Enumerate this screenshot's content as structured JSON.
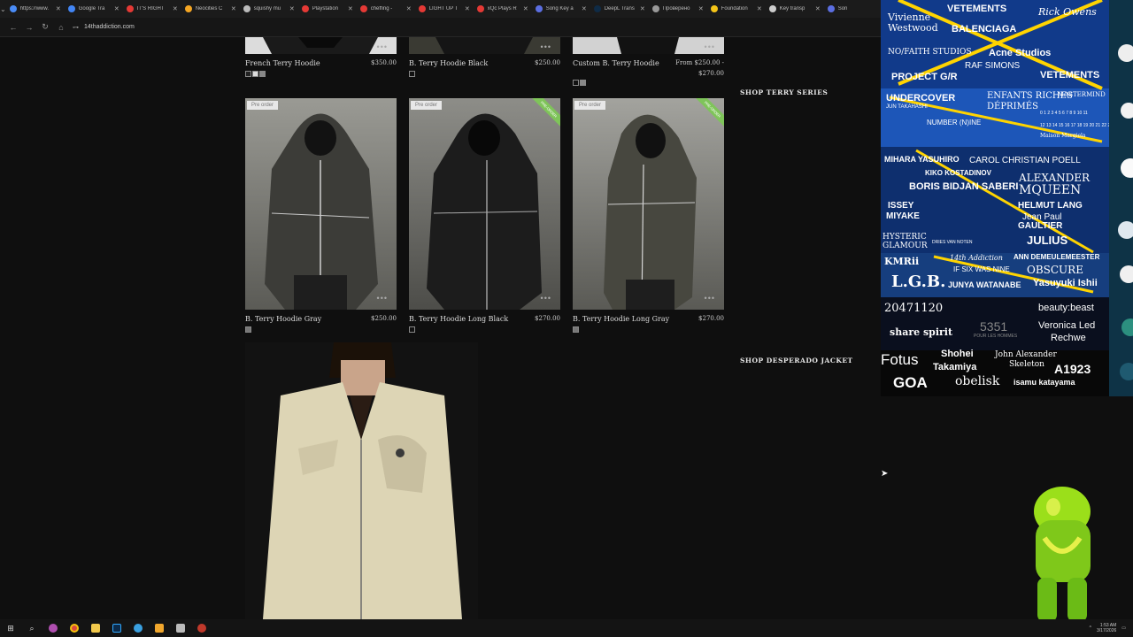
{
  "browser": {
    "tabs": [
      {
        "label": "https://www.",
        "color": "#4a8cf7"
      },
      {
        "label": "Google Tra",
        "color": "#4285f4"
      },
      {
        "label": "IT'S RIGHT",
        "color": "#e53935"
      },
      {
        "label": "Neocities C",
        "color": "#f5a623"
      },
      {
        "label": "squishy mu",
        "color": "#bbbbbb"
      },
      {
        "label": "Playstation",
        "color": "#e53935"
      },
      {
        "label": "cheffing -",
        "color": "#e53935"
      },
      {
        "label": "LIGHT UP T",
        "color": "#e53935"
      },
      {
        "label": "xQc Plays R",
        "color": "#e53935"
      },
      {
        "label": "Song Key a",
        "color": "#5b6ee1"
      },
      {
        "label": "DeepL Trans",
        "color": "#0f2b46"
      },
      {
        "label": "Проверено",
        "color": "#999999"
      },
      {
        "label": "Foundation",
        "color": "#f5c518"
      },
      {
        "label": "Key transp",
        "color": "#cccccc"
      },
      {
        "label": "Son",
        "color": "#5b6ee1"
      }
    ],
    "tab_close": "✕",
    "tab_list_icon": "⌄",
    "nav": {
      "back": "←",
      "forward": "→",
      "reload": "↻",
      "home": "⌂"
    },
    "url": "14thaddiction.com",
    "site_icon": "⊶"
  },
  "products": [
    {
      "name": "French Terry Hoodie",
      "price": "$350.00",
      "swatches": [
        "#222222",
        "#dddddd",
        "#888888"
      ]
    },
    {
      "name": "B. Terry Hoodie Black",
      "price": "$250.00",
      "swatches": [
        "#111111"
      ]
    },
    {
      "name": "Custom B. Terry Hoodie",
      "price": "From $250.00 -",
      "price2": "$270.00",
      "swatches": [
        "#111111",
        "#888888"
      ]
    },
    {
      "name": "B. Terry Hoodie Gray",
      "price": "$250.00",
      "badge": "Pre order",
      "swatches": [
        "#777777"
      ]
    },
    {
      "name": "B. Terry Hoodie Long Black",
      "price": "$270.00",
      "badge": "Pre order",
      "ribbon": "PRE-ORDER",
      "swatches": [
        "#111111"
      ]
    },
    {
      "name": "B. Terry Hoodie Long Gray",
      "price": "$270.00",
      "badge": "Pre order",
      "ribbon": "PRE-ORDER",
      "swatches": [
        "#777777"
      ]
    }
  ],
  "more_icon": "•••",
  "shop_links": {
    "terry": "SHOP TERRY SERIES",
    "desperado": "SHOP DESPERADO JACKET"
  },
  "collage": {
    "brands": [
      {
        "text": "Vivienne",
        "color": "#ffffff"
      },
      {
        "text": "Westwood",
        "color": "#ffffff"
      },
      {
        "text": "VETEMENTS",
        "color": "#ffffff"
      },
      {
        "text": "BALENCIAGA",
        "color": "#ffffff"
      },
      {
        "text": "Rick Owens",
        "color": "#ffffff"
      },
      {
        "text": "NO/FAITH STUDIOS",
        "color": "#ffffff"
      },
      {
        "text": "Acne Studios",
        "color": "#ffffff"
      },
      {
        "text": "RAF SIMONS",
        "color": "#ffffff"
      },
      {
        "text": "PROJECT G/R",
        "color": "#ffffff"
      },
      {
        "text": "VETEMENTS",
        "color": "#ffffff"
      },
      {
        "text": "UNDERCOVER",
        "color": "#ffffff"
      },
      {
        "text": "JUN TAKAHASHI",
        "color": "#ffffff"
      },
      {
        "text": "ENFANTS RICHES",
        "color": "#ffffff"
      },
      {
        "text": "DÉPRIMÉS",
        "color": "#ffffff"
      },
      {
        "text": "MASTERMIND",
        "color": "#ffffff"
      },
      {
        "text": "NUMBER (N)INE",
        "color": "#ffffff"
      },
      {
        "text": "0 1 2 3 4 5 6 7 8 9 10 11",
        "color": "#ffffff"
      },
      {
        "text": "12 13 14 15 16 17 18 19 20 21 22 23",
        "color": "#ffffff"
      },
      {
        "text": "Maison Margiela",
        "color": "#ffffff"
      },
      {
        "text": "MIHARA YASUHIRO",
        "color": "#ffffff"
      },
      {
        "text": "CAROL CHRISTIAN POELL",
        "color": "#ffffff"
      },
      {
        "text": "KIKO KOSTADINOV",
        "color": "#ffffff"
      },
      {
        "text": "BORIS BIDJAN SABERI",
        "color": "#ffffff"
      },
      {
        "text": "ALEXANDER",
        "color": "#ffffff"
      },
      {
        "text": "MQUEEN",
        "color": "#ffffff"
      },
      {
        "text": "ISSEY",
        "color": "#ffffff"
      },
      {
        "text": "MIYAKE",
        "color": "#ffffff"
      },
      {
        "text": "HELMUT LANG",
        "color": "#ffffff"
      },
      {
        "text": "Jean Paul",
        "color": "#ffffff"
      },
      {
        "text": "GAULTIER",
        "color": "#ffffff"
      },
      {
        "text": "HYSTERIC",
        "color": "#ffffff"
      },
      {
        "text": "GLAMOUR",
        "color": "#ffffff"
      },
      {
        "text": "DRIES VAN NOTEN",
        "color": "#ffffff"
      },
      {
        "text": "JULIUS",
        "color": "#ffffff"
      },
      {
        "text": "ANN DEMEULEMEESTER",
        "color": "#ffffff"
      },
      {
        "text": "KMRii",
        "color": "#ffffff"
      },
      {
        "text": "14th Addiction",
        "color": "#ffffff"
      },
      {
        "text": "IF SIX WAS NINE",
        "color": "#ffffff"
      },
      {
        "text": "OBSCURE",
        "color": "#ffffff"
      },
      {
        "text": "L.G.B.",
        "color": "#ffffff"
      },
      {
        "text": "JUNYA WATANABE",
        "color": "#ffffff"
      },
      {
        "text": "Yasuyuki Ishii",
        "color": "#ffffff"
      },
      {
        "text": "20471120",
        "color": "#ffffff"
      },
      {
        "text": "beauty:beast",
        "color": "#ffffff"
      },
      {
        "text": "5351",
        "color": "#ffffff"
      },
      {
        "text": "POUR LES HOMMES",
        "color": "#ffffff"
      },
      {
        "text": "Veronica Led",
        "color": "#ffffff"
      },
      {
        "text": "Rechwe",
        "color": "#ffffff"
      },
      {
        "text": "share spirit",
        "color": "#ffffff"
      },
      {
        "text": "Fotus",
        "color": "#ffffff"
      },
      {
        "text": "Shohei",
        "color": "#ffffff"
      },
      {
        "text": "Takamiya",
        "color": "#ffffff"
      },
      {
        "text": "John Alexander",
        "color": "#ffffff"
      },
      {
        "text": "Skeleton",
        "color": "#ffffff"
      },
      {
        "text": "A1923",
        "color": "#ffffff"
      },
      {
        "text": "GOA",
        "color": "#ffffff"
      },
      {
        "text": "obelisk",
        "color": "#ffffff"
      },
      {
        "text": "isamu katayama",
        "color": "#ffffff"
      }
    ]
  },
  "taskbar": {
    "start_icon": "⊞",
    "search_icon": "⌕",
    "tray_chevron": "^",
    "clock_time": "1:53 AM",
    "clock_date": "3/17/2026",
    "notification_icon": "▭"
  }
}
